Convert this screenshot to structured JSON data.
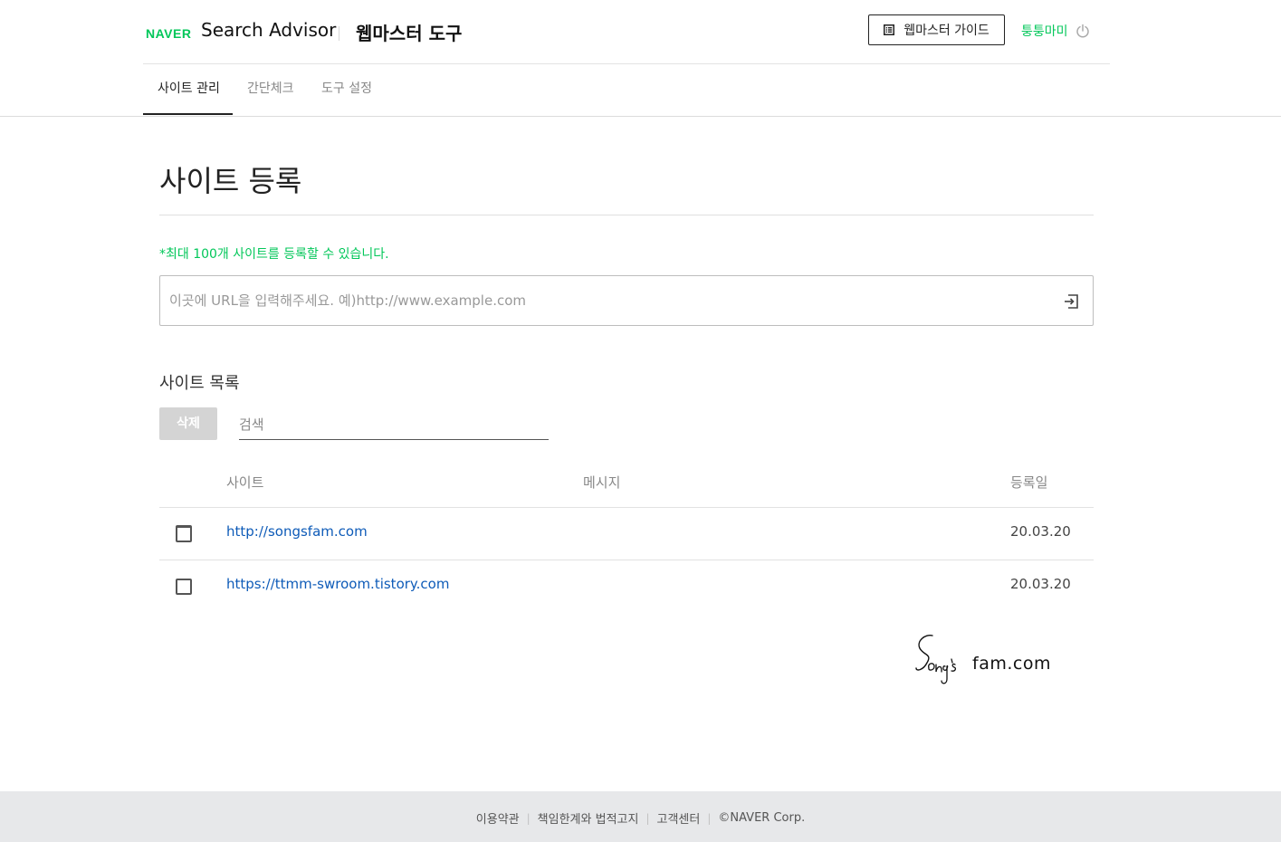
{
  "header": {
    "naver_logo": "NAVER",
    "service_name": "Search Advisor",
    "tool_name": "웹마스터 도구",
    "guide_button": "웹마스터 가이드",
    "user_name": "퉁퉁마미"
  },
  "tabs": [
    {
      "label": "사이트 관리",
      "active": true
    },
    {
      "label": "간단체크",
      "active": false
    },
    {
      "label": "도구 설정",
      "active": false
    }
  ],
  "main": {
    "page_title": "사이트 등록",
    "notice": "*최대 100개 사이트를 등록할 수 있습니다.",
    "url_input": {
      "value": "",
      "placeholder": "이곳에 URL을 입력해주세요. 예)http://www.example.com"
    },
    "list_title": "사이트 목록",
    "delete_button": "삭제",
    "search": {
      "value": "",
      "placeholder": "검색"
    }
  },
  "table": {
    "headers": {
      "site": "사이트",
      "message": "메시지",
      "date": "등록일"
    },
    "rows": [
      {
        "site": "http://songsfam.com",
        "message": "",
        "date": "20.03.20",
        "checked": false
      },
      {
        "site": "https://ttmm-swroom.tistory.com",
        "message": "",
        "date": "20.03.20",
        "checked": false
      }
    ]
  },
  "watermark": {
    "text": "fam.com"
  },
  "footer": {
    "links": [
      "이용약관",
      "책임한계와 법적고지",
      "고객센터",
      "©NAVER Corp."
    ]
  },
  "colors": {
    "brand_green": "#03c75a",
    "link_blue": "#0e5bb8",
    "footer_bg": "#e7e8ea",
    "disabled_button": "#d4d4d4"
  },
  "icons": {
    "guide": "document-list-icon",
    "logout": "power-icon",
    "submit": "enter-arrow-icon"
  }
}
